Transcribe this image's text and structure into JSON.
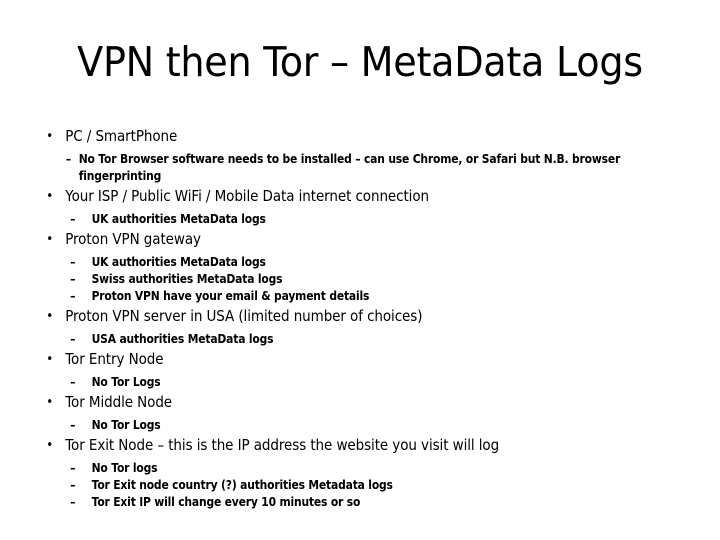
{
  "slide": {
    "title": "VPN then Tor – MetaData Logs",
    "bullet_marker": "•",
    "sub_bullet_marker": "–",
    "bullets": [
      {
        "text": "PC / SmartPhone",
        "subs": [
          {
            "text": "No  Tor Browser software needs to be installed – can use Chrome, or Safari but N.B.  browser",
            "cont": "fingerprinting"
          }
        ]
      },
      {
        "text": "Your ISP / Public WiFi / Mobile Data internet connection",
        "subs": [
          {
            "text": "UK authorities MetaData logs"
          }
        ]
      },
      {
        "text": "Proton VPN gateway",
        "subs": [
          {
            "text": "UK authorities MetaData logs"
          },
          {
            "text": "Swiss authorities MetaData logs"
          },
          {
            "text": "Proton VPN have your email & payment details"
          }
        ]
      },
      {
        "text": "Proton VPN server in USA (limited number of choices)",
        "subs": [
          {
            "text": "USA authorities MetaData logs"
          }
        ]
      },
      {
        "text": "Tor Entry Node",
        "subs": [
          {
            "text": "No Tor Logs"
          }
        ]
      },
      {
        "text": "Tor Middle Node",
        "subs": [
          {
            "text": "No Tor Logs"
          }
        ]
      },
      {
        "text": "Tor Exit Node – this is the IP address the website you visit will log",
        "subs": [
          {
            "text": "No Tor logs"
          },
          {
            "text": "Tor Exit node country (?) authorities Metadata logs"
          },
          {
            "text": "Tor Exit IP will change every 10 minutes or so"
          }
        ]
      }
    ]
  },
  "colors": {
    "background": "#ffffff",
    "text": "#000000"
  }
}
